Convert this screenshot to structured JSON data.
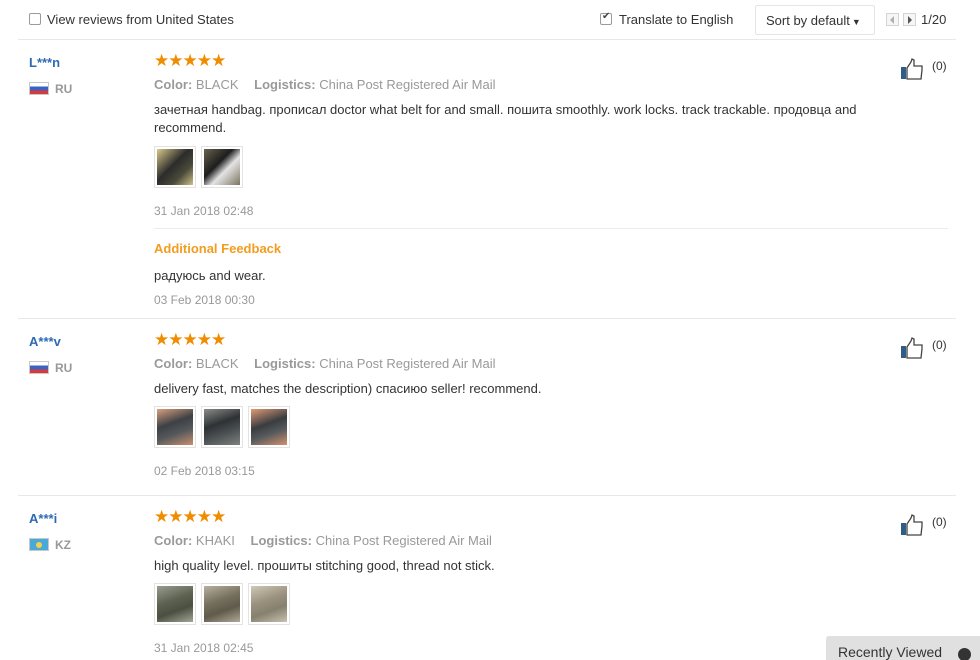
{
  "topbar": {
    "view_reviews_label": "View reviews from United States",
    "view_reviews_checked": false,
    "translate_label": "Translate to English",
    "translate_checked": true,
    "sort_label": "Sort by default",
    "page_indicator": "1/20"
  },
  "reviews": [
    {
      "user": "L***n",
      "country": "RU",
      "stars": "★★★★★",
      "rating": 5,
      "color_label": "Color:",
      "color_value": "BLACK",
      "logistics_label": "Logistics:",
      "logistics_value": "China Post Registered Air Mail",
      "text": "зачетная handbag. прописал doctor what belt for and small. пошита smoothly. work locks. track trackable. продовца and recommend.",
      "date": "31 Jan 2018 02:48",
      "likes": "(0)",
      "additional": {
        "title": "Additional Feedback",
        "text": "радуюсь and wear.",
        "date": "03 Feb 2018 00:30"
      }
    },
    {
      "user": "A***v",
      "country": "RU",
      "stars": "★★★★★",
      "rating": 5,
      "color_label": "Color:",
      "color_value": "BLACK",
      "logistics_label": "Logistics:",
      "logistics_value": "China Post Registered Air Mail",
      "text": "delivery fast, matches the description) спасиюо seller! recommend.",
      "date": "02 Feb 2018 03:15",
      "likes": "(0)"
    },
    {
      "user": "A***i",
      "country": "KZ",
      "stars": "★★★★★",
      "rating": 5,
      "color_label": "Color:",
      "color_value": "KHAKI",
      "logistics_label": "Logistics:",
      "logistics_value": "China Post Registered Air Mail",
      "text": "high quality level. прошиты stitching good, thread not stick.",
      "date": "31 Jan 2018 02:45",
      "likes": "(0)"
    }
  ],
  "recently_viewed": {
    "label": "Recently Viewed"
  },
  "colors": {
    "accent_orange": "#f08c00",
    "feedback_orange": "#f29d1f",
    "username_blue": "#2d6ab4",
    "muted_grey": "#999999"
  }
}
